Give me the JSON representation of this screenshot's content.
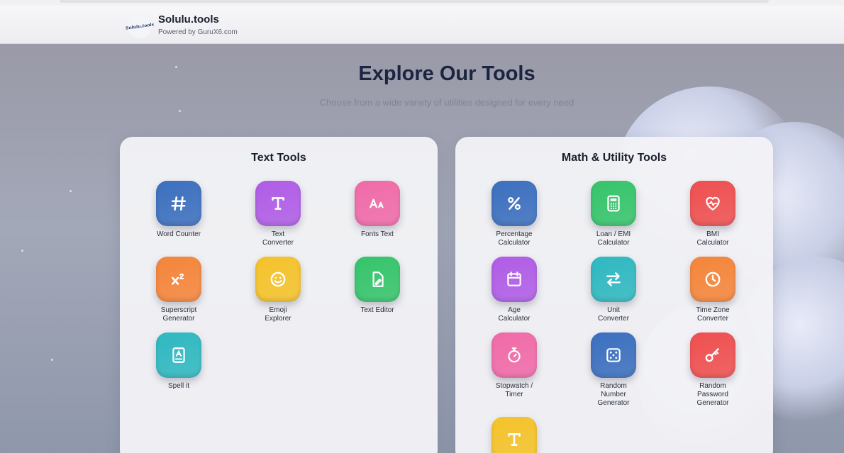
{
  "header": {
    "logo_text": "Solulu.tools",
    "brand_name": "Solulu.tools",
    "brand_sub": "Powered by GuruX6.com"
  },
  "hero": {
    "title": "Explore Our Tools",
    "subtitle": "Choose from a wide variety of utilities designed for every need"
  },
  "text_tools": {
    "title": "Text Tools",
    "items": [
      {
        "label": "Word Counter",
        "icon": "hash-icon",
        "color": "#3b6fbe"
      },
      {
        "label": "Text\nConverter",
        "icon": "text-t-icon",
        "color": "#b05ce6"
      },
      {
        "label": "Fonts Text",
        "icon": "font-aa-icon",
        "color": "#f06aa8"
      },
      {
        "label": "Superscript\nGenerator",
        "icon": "superscript-icon",
        "color": "#f4853a"
      },
      {
        "label": "Emoji\nExplorer",
        "icon": "smiley-icon",
        "color": "#f4c22a"
      },
      {
        "label": "Text Editor",
        "icon": "edit-file-icon",
        "color": "#35c46a"
      },
      {
        "label": "Spell it",
        "icon": "spell-book-icon",
        "color": "#2fb8c0"
      }
    ]
  },
  "math_tools": {
    "title": "Math & Utility Tools",
    "items": [
      {
        "label": "Percentage\nCalculator",
        "icon": "percent-icon",
        "color": "#3b6fbe"
      },
      {
        "label": "Loan / EMI\nCalculator",
        "icon": "calculator-icon",
        "color": "#35c46a"
      },
      {
        "label": "BMI\nCalculator",
        "icon": "heart-pulse-icon",
        "color": "#ef4f4f"
      },
      {
        "label": "Age\nCalculator",
        "icon": "calendar-icon",
        "color": "#b05ce6"
      },
      {
        "label": "Unit\nConverter",
        "icon": "swap-arrows-icon",
        "color": "#2fb8c0"
      },
      {
        "label": "Time Zone\nConverter",
        "icon": "clock-icon",
        "color": "#f4853a"
      },
      {
        "label": "Stopwatch /\nTimer",
        "icon": "stopwatch-icon",
        "color": "#f06aa8"
      },
      {
        "label": "Random\nNumber\nGenerator",
        "icon": "dice-icon",
        "color": "#3b6fbe"
      },
      {
        "label": "Random\nPassword\nGenerator",
        "icon": "key-icon",
        "color": "#ef4f4f"
      },
      {
        "label": "",
        "icon": "text-t-icon",
        "color": "#f4c22a"
      }
    ]
  }
}
